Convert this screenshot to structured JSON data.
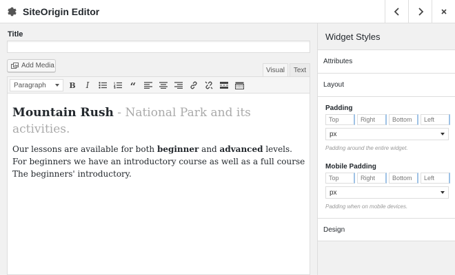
{
  "header": {
    "title": "SiteOrigin Editor",
    "icons": {
      "settings": "gear-icon",
      "prev": "chevron-left-icon",
      "next": "chevron-right-icon",
      "close": "close-icon"
    }
  },
  "main": {
    "title_label": "Title",
    "title_value": "",
    "add_media_label": "Add Media",
    "tabs": [
      {
        "label": "Visual"
      },
      {
        "label": "Text"
      }
    ],
    "format_select": "Paragraph",
    "content": {
      "heading_bold": "Mountain Rush",
      "heading_rest": " - National Park and its activities.",
      "p1": "Our lessons are available for both ",
      "p_bold1": "beginner",
      "p2": " and ",
      "p_bold2": "advanced",
      "p3": " levels. For beginners we have an introductory course as well as a full course The beginners' introductory."
    }
  },
  "side": {
    "title": "Widget Styles",
    "sections": {
      "attributes": "Attributes",
      "layout": "Layout",
      "design": "Design"
    },
    "padding": {
      "label": "Padding",
      "fields": [
        "Top",
        "Right",
        "Bottom",
        "Left"
      ],
      "unit": "px",
      "help": "Padding around the entire widget."
    },
    "mobile_padding": {
      "label": "Mobile Padding",
      "fields": [
        "Top",
        "Right",
        "Bottom",
        "Left"
      ],
      "unit": "px",
      "help": "Padding when on mobile devices."
    }
  },
  "colors": {
    "accent": "#9ec2e6",
    "border": "#dddddd",
    "text": "#23282d"
  }
}
